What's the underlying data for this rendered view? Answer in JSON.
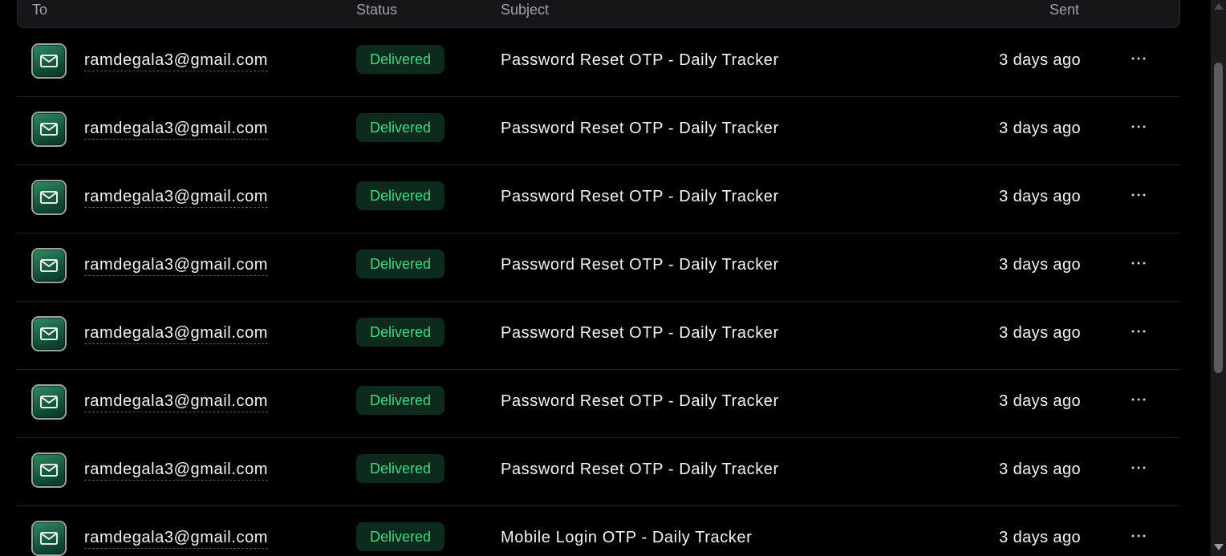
{
  "table": {
    "headers": {
      "to": "To",
      "status": "Status",
      "subject": "Subject",
      "sent": "Sent"
    },
    "rows": [
      {
        "to": "ramdegala3@gmail.com",
        "status": "Delivered",
        "subject": "Password Reset OTP - Daily Tracker",
        "sent": "3 days ago"
      },
      {
        "to": "ramdegala3@gmail.com",
        "status": "Delivered",
        "subject": "Password Reset OTP - Daily Tracker",
        "sent": "3 days ago"
      },
      {
        "to": "ramdegala3@gmail.com",
        "status": "Delivered",
        "subject": "Password Reset OTP - Daily Tracker",
        "sent": "3 days ago"
      },
      {
        "to": "ramdegala3@gmail.com",
        "status": "Delivered",
        "subject": "Password Reset OTP - Daily Tracker",
        "sent": "3 days ago"
      },
      {
        "to": "ramdegala3@gmail.com",
        "status": "Delivered",
        "subject": "Password Reset OTP - Daily Tracker",
        "sent": "3 days ago"
      },
      {
        "to": "ramdegala3@gmail.com",
        "status": "Delivered",
        "subject": "Password Reset OTP - Daily Tracker",
        "sent": "3 days ago"
      },
      {
        "to": "ramdegala3@gmail.com",
        "status": "Delivered",
        "subject": "Password Reset OTP - Daily Tracker",
        "sent": "3 days ago"
      },
      {
        "to": "ramdegala3@gmail.com",
        "status": "Delivered",
        "subject": "Mobile Login OTP - Daily Tracker",
        "sent": "3 days ago"
      }
    ]
  },
  "icons": {
    "row_icon": "mail-icon",
    "row_action": "more-horizontal-icon"
  },
  "colors": {
    "background": "#000000",
    "delivered_text": "#3ddc84",
    "delivered_bg": "#0c2b1d",
    "icon_green": "#2f8a61"
  }
}
